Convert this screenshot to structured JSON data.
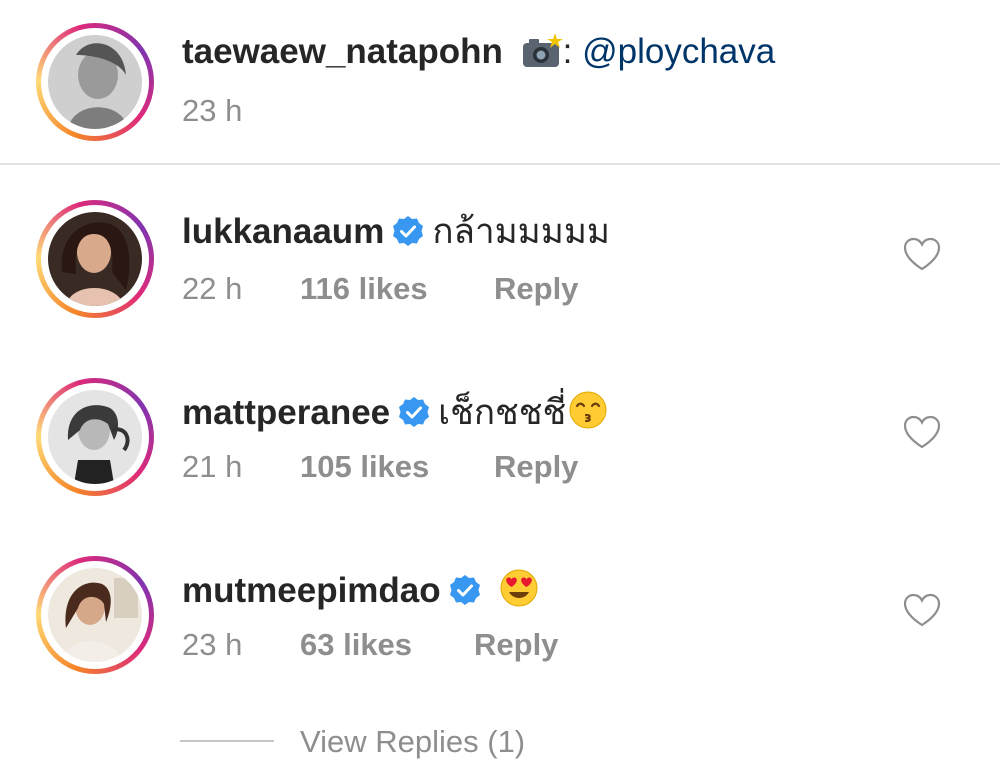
{
  "caption": {
    "username": "taewaew_natapohn",
    "camera_emoji": "camera-with-flash",
    "text": ": ",
    "mention": "@ploychava",
    "time": "23 h"
  },
  "comments": [
    {
      "username": "lukkanaaum",
      "verified": true,
      "text": "กล้ามมมมม",
      "time": "22 h",
      "likes": "116 likes",
      "reply": "Reply"
    },
    {
      "username": "mattperanee",
      "verified": true,
      "text": "เช็กชชชี่",
      "emoji": "kissing-face-with-closed-eyes",
      "time": "21 h",
      "likes": "105 likes",
      "reply": "Reply"
    },
    {
      "username": "mutmeepimdao",
      "verified": true,
      "text": "",
      "emoji": "smiling-face-with-heart-eyes",
      "time": "23 h",
      "likes": "63 likes",
      "reply": "Reply"
    }
  ],
  "view_replies": "View Replies (1)",
  "colors": {
    "text": "#262626",
    "muted": "#8e8e8e",
    "mention": "#003569",
    "verified": "#3897f0"
  }
}
